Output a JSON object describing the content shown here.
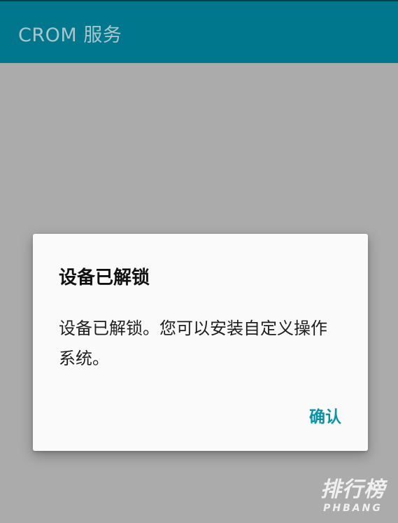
{
  "app_bar": {
    "title": "CROM 服务",
    "color": "#00778d"
  },
  "dialog": {
    "title": "设备已解锁",
    "message": "设备已解锁。您可以安装自定义操作系统。",
    "confirm_label": "确认",
    "accent_color": "#0a92a8"
  },
  "watermark": {
    "chinese": "排行榜",
    "english": "PHBANG"
  }
}
